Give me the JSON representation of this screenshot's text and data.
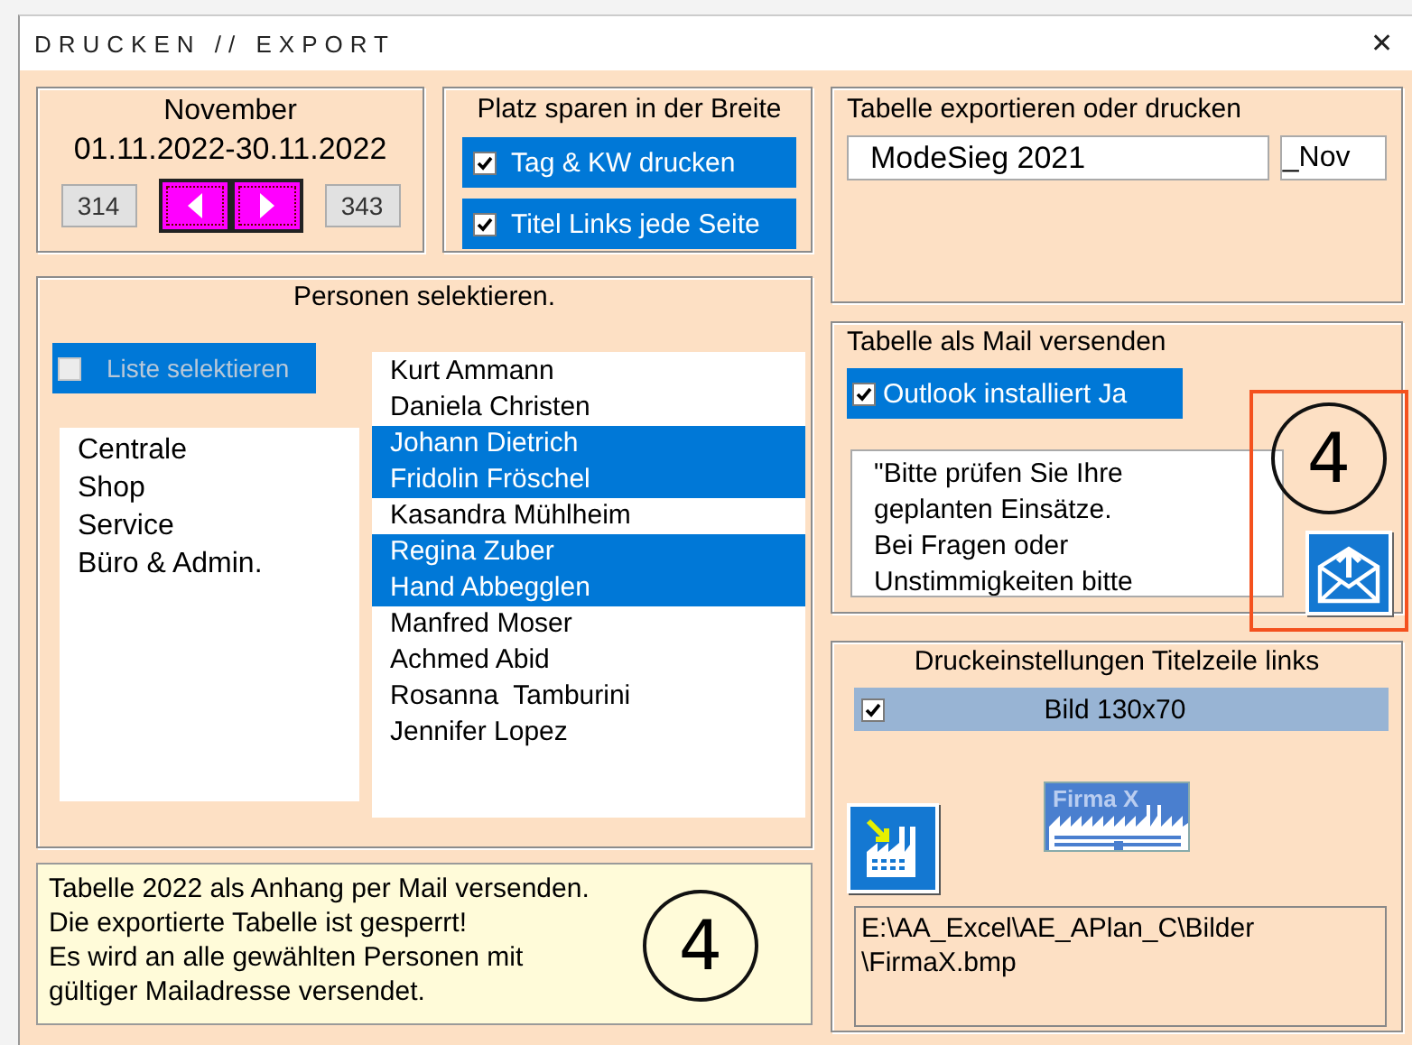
{
  "window": {
    "title": "DRUCKEN // EXPORT",
    "close": "✕"
  },
  "period": {
    "month": "November",
    "range": "01.11.2022-30.11.2022",
    "start_no": "314",
    "end_no": "343"
  },
  "space_saving": {
    "title": "Platz sparen in der Breite",
    "options": [
      {
        "label": "Tag & KW drucken",
        "checked": true
      },
      {
        "label": "Titel Links jede Seite",
        "checked": true
      }
    ]
  },
  "persons": {
    "title": "Personen selektieren.",
    "select_list": {
      "label": "Liste selektieren",
      "checked": false,
      "disabled": true
    },
    "groups": [
      "Centrale",
      "Shop",
      "Service",
      "Büro & Admin."
    ],
    "people": [
      {
        "name": "Kurt Ammann",
        "selected": false
      },
      {
        "name": "Daniela Christen",
        "selected": false
      },
      {
        "name": "Johann Dietrich",
        "selected": true
      },
      {
        "name": "Fridolin Fröschel",
        "selected": true
      },
      {
        "name": "Kasandra Mühlheim",
        "selected": false
      },
      {
        "name": "Regina Zuber",
        "selected": true
      },
      {
        "name": "Hand Abbegglen",
        "selected": true
      },
      {
        "name": "Manfred Moser",
        "selected": false
      },
      {
        "name": "Achmed Abid",
        "selected": false
      },
      {
        "name": "Rosanna  Tamburini",
        "selected": false
      },
      {
        "name": "Jennifer Lopez",
        "selected": false
      }
    ]
  },
  "note": {
    "lines": [
      "Tabelle 2022 als Anhang per Mail versenden.",
      "Die exportierte Tabelle ist gesperrt!",
      "Es wird an alle gewählten Personen mit",
      "gültiger Mailadresse versendet."
    ],
    "annotation": "4"
  },
  "export": {
    "title": "Tabelle exportieren oder drucken",
    "file_name": "ModeSieg 2021",
    "suffix": "_Nov"
  },
  "mail": {
    "title": "Tabelle als Mail versenden",
    "outlook": {
      "label": "Outlook installiert Ja",
      "checked": true
    },
    "message_lines": [
      "\"Bitte prüfen Sie Ihre",
      "geplanten Einsätze.",
      "Bei Fragen oder",
      "Unstimmigkeiten bitte"
    ],
    "annotation": "4"
  },
  "print_settings": {
    "title": "Druckeinstellungen Titelzeile links",
    "image_option": {
      "label": "Bild 130x70",
      "checked": true
    },
    "logo_text": "Firma X",
    "path_lines": [
      "E:\\AA_Excel\\AE_APlan_C\\Bilder",
      "\\FirmaX.bmp"
    ]
  }
}
